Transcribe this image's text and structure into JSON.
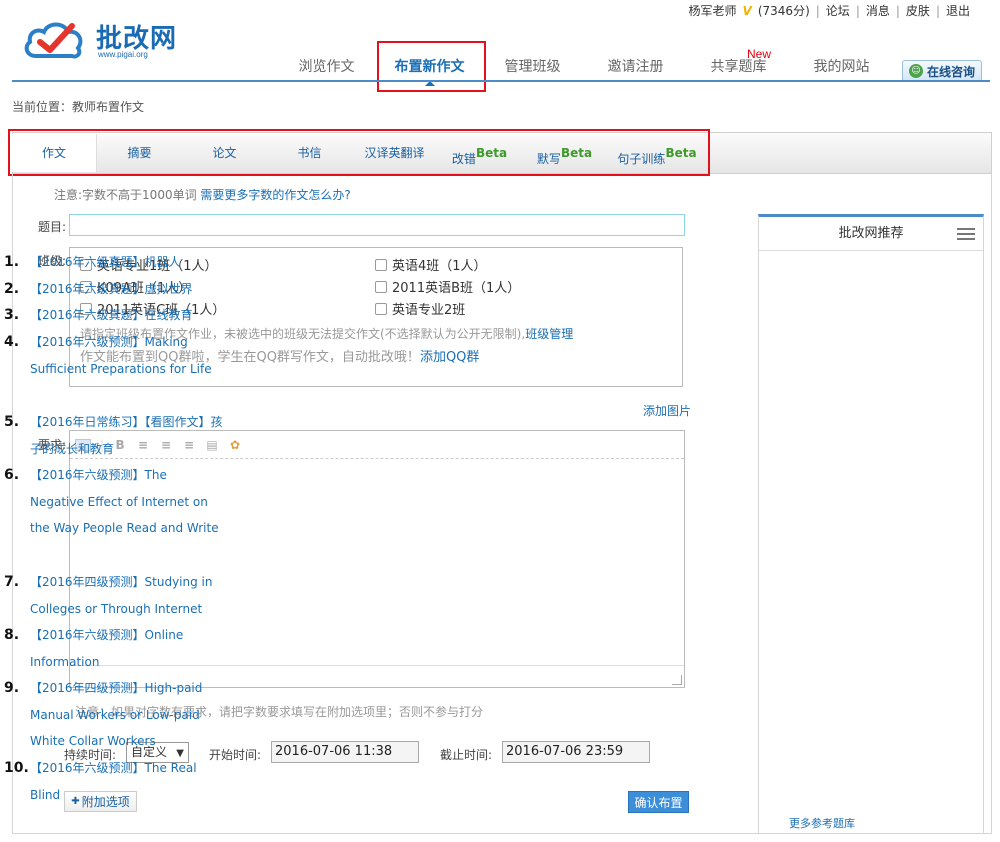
{
  "user": {
    "name": "杨军老师",
    "vip": "V",
    "points": "(7346分)"
  },
  "top_links": [
    "论坛",
    "消息",
    "皮肤",
    "退出"
  ],
  "logo": {
    "title": "批改网",
    "url": "www.pigai.org"
  },
  "nav": {
    "items": [
      "浏览作文",
      "布置新作文",
      "管理班级",
      "邀请注册",
      "共享题库",
      "我的网站"
    ],
    "new_badge": "New",
    "consult": "在线咨询"
  },
  "breadcrumb": "当前位置：教师布置作文",
  "tabs": [
    {
      "label": "作文",
      "beta": ""
    },
    {
      "label": "摘要",
      "beta": ""
    },
    {
      "label": "论文",
      "beta": ""
    },
    {
      "label": "书信",
      "beta": ""
    },
    {
      "label": "汉译英翻译",
      "beta": ""
    },
    {
      "label": "改错",
      "beta": "Beta"
    },
    {
      "label": "默写",
      "beta": "Beta"
    },
    {
      "label": "句子训练",
      "beta": "Beta"
    }
  ],
  "form": {
    "note_prefix": "注意:字数不高于1000单词",
    "note_link": "需要更多字数的作文怎么办?",
    "title_label": "题目:",
    "title_value": "",
    "class_label": "班级:",
    "classes": [
      "英语专业1班（1人）",
      "英语4班（1人）",
      "K09A班（1人）",
      "2011英语B班（1人）",
      "2011英语C班（1人）",
      "英语专业2班"
    ],
    "class_hint": "请指定班级布置作文作业，未被选中的班级无法提交作文(不选择默认为公开无限制),",
    "class_manage": "班级管理",
    "qq_hint": "作文能布置到QQ群啦，学生在QQ群写作文，自动批改哦！",
    "qq_link": "添加QQ群",
    "add_image": "添加图片",
    "req_label": "要求:",
    "editor_text": "",
    "word_note": "注意：如果对字数有要求，请把字数要求填写在附加选项里；否则不参与打分",
    "duration_label": "持续时间:",
    "duration_value": "自定义",
    "start_label": "开始时间:",
    "start_value": "2016-07-06 11:38",
    "end_label": "截止时间:",
    "end_value": "2016-07-06 23:59",
    "extra_options": "附加选项",
    "confirm": "确认布置"
  },
  "sidebar": {
    "title": "批改网推荐",
    "items": [
      "【2016年六级真题】机器人",
      "【2016年六级真题】虚拟世界",
      "【2016年六级真题】在线教育",
      "【2016年六级预测】Making Sufficient Preparations for Life",
      "【2016年日常练习】【看图作文】孩子的成长和教育",
      "【2016年六级预测】The Negative Effect of Internet on the Way People Read and Write",
      "【2016年四级预测】Studying in Colleges or Through Internet",
      "【2016年六级预测】Online Information",
      "【2016年四级预测】High-paid Manual Workers or Low-paid White Collar Workers",
      "【2016年六级预测】The Real Blind"
    ],
    "more": "更多参考题库"
  }
}
